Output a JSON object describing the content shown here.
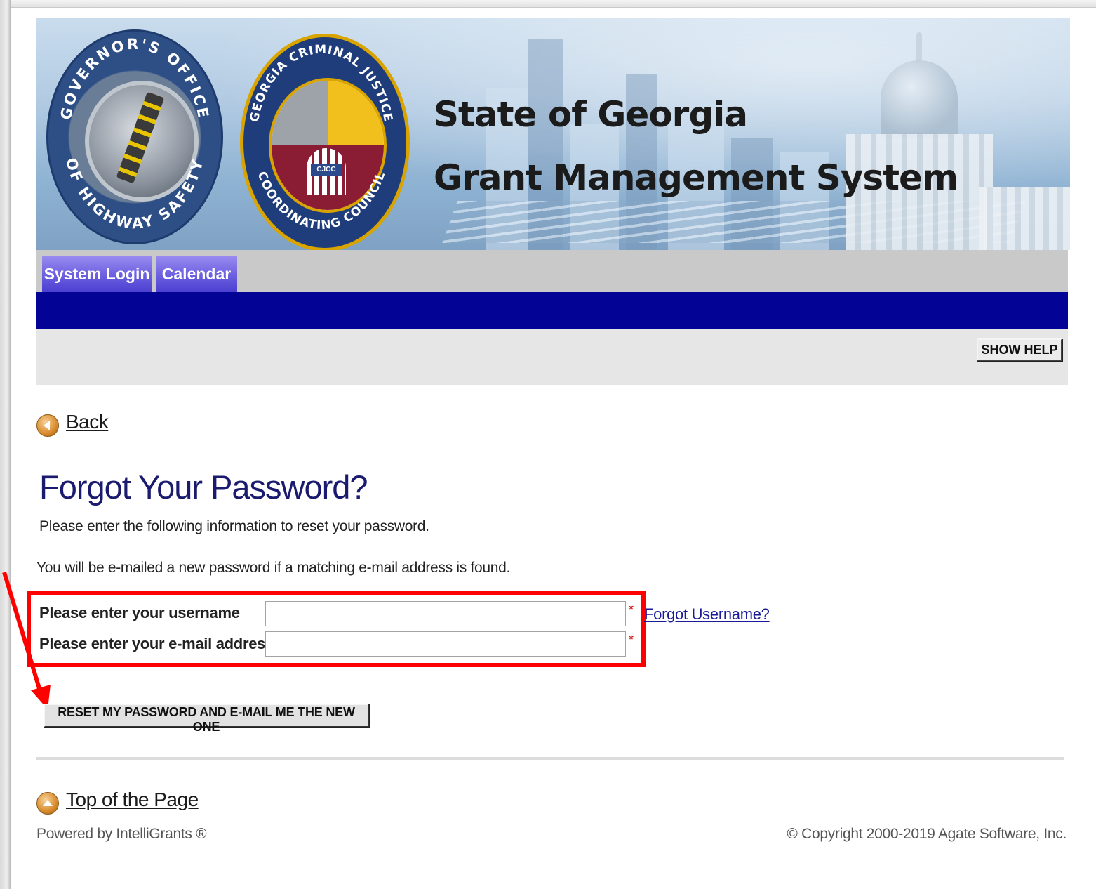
{
  "banner": {
    "title_line1": "State of Georgia",
    "title_line2": "Grant Management System",
    "seal_left_text_top": "GOVERNOR'S OFFICE",
    "seal_left_text_bottom": "OF HIGHWAY SAFETY",
    "seal_right_text_top": "GEORGIA CRIMINAL JUSTICE",
    "seal_right_text_bottom": "COORDINATING COUNCIL",
    "seal_right_label": "CJCC"
  },
  "tabs": [
    {
      "label": "System Login"
    },
    {
      "label": "Calendar"
    }
  ],
  "help": {
    "show_help_label": "SHOW HELP"
  },
  "nav": {
    "back_label": "Back",
    "top_label": "Top of the Page"
  },
  "page": {
    "title": "Forgot Your Password?",
    "intro": "Please enter the following information to reset your password.",
    "note": "You will be e-mailed a new password if a matching e-mail address is found."
  },
  "form": {
    "username_label": "Please enter your username",
    "username_value": "",
    "email_label": "Please enter your e-mail address",
    "email_value": "",
    "required_mark": "*",
    "forgot_username_label": "Forgot Username?",
    "reset_button_label": "RESET MY PASSWORD AND E-MAIL ME THE NEW ONE"
  },
  "footer": {
    "powered_by": "Powered by IntelliGrants ®",
    "copyright": "© Copyright 2000-2019 Agate Software, Inc."
  },
  "colors": {
    "nav_band": "#030395",
    "tab": "#6b5fe0",
    "title": "#1a1a6e",
    "highlight": "#ff0000"
  }
}
